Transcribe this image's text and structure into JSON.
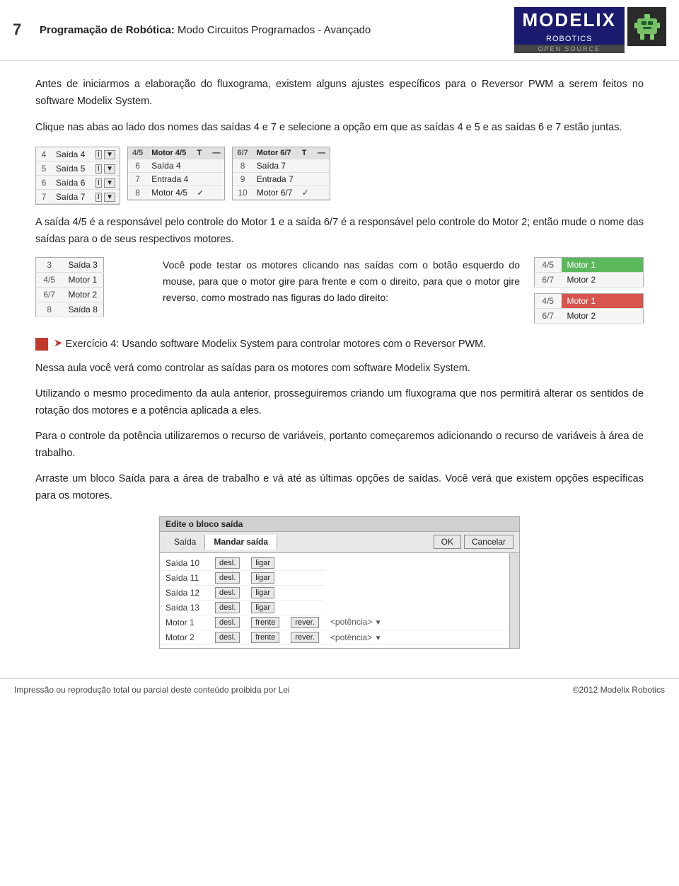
{
  "header": {
    "page_number": "7",
    "title_plain": "Programação de Robótica:",
    "title_subtitle": " Modo Circuitos Programados - Avançado",
    "logo_main": "MODELIX",
    "logo_sub": "ROBOTICS",
    "logo_open": "OPEN SOURCE"
  },
  "intro": {
    "para1": "Antes de iniciarmos a elaboração do fluxograma, existem alguns ajustes específicos para o Reversor PWM a serem feitos no software Modelix System.",
    "para2": "Clique nas abas ao lado dos nomes das saídas 4 e 7 e selecione a opção em que as saídas 4 e 5 e as saídas 6 e 7 estão juntas."
  },
  "ui_table1": {
    "rows": [
      {
        "num": "4",
        "label": "Saída 4"
      },
      {
        "num": "5",
        "label": "Saída 5"
      },
      {
        "num": "6",
        "label": "Saída 6"
      },
      {
        "num": "7",
        "label": "Saída 7"
      }
    ]
  },
  "ui_table2": {
    "header": "Motor 4/5",
    "rows": [
      {
        "num": "6",
        "label": "Saída 4"
      },
      {
        "num": "7",
        "label": "Entrada 4"
      },
      {
        "num": "8",
        "label": "Motor 4/5",
        "checked": true
      }
    ]
  },
  "ui_table3": {
    "header": "Motor 6/7",
    "rows": [
      {
        "num": "8",
        "label": "Saída 7"
      },
      {
        "num": "9",
        "label": "Entrada 7"
      },
      {
        "num": "10",
        "label": "Motor 6/7",
        "checked": true
      }
    ]
  },
  "section1_text": "A saída 4/5 é a responsável pelo controle do Motor 1 e a saída 6/7 é a responsável pelo controle do Motor 2; então mude o nome das saídas para o de seus respectivos motores.",
  "section2_text": "Você pode testar os motores clicando nas saídas com o botão esquerdo do mouse, para que o motor gire para frente e com o direito, para que o motor gire reverso, como mostrado nas figuras do lado direito:",
  "motor_left_table": {
    "rows": [
      {
        "num": "3",
        "label": "Saída 3"
      },
      {
        "num": "4/5",
        "label": "Motor 1"
      },
      {
        "num": "6/7",
        "label": "Motor 2"
      },
      {
        "num": "8",
        "label": "Saída 8"
      }
    ]
  },
  "motor_right_top": {
    "rows": [
      {
        "num": "4/5",
        "label": "Motor 1",
        "style": "green"
      },
      {
        "num": "6/7",
        "label": "Motor 2",
        "style": "normal"
      }
    ]
  },
  "motor_right_bottom": {
    "rows": [
      {
        "num": "4/5",
        "label": "Motor 1",
        "style": "red"
      },
      {
        "num": "6/7",
        "label": "Motor 2",
        "style": "normal"
      }
    ]
  },
  "exercise": {
    "label": "Exercício 4: Usando software Modelix System para controlar motores com o Reversor PWM."
  },
  "para_nessa": "Nessa aula você verá como controlar as saídas para os motores com software Modelix System.",
  "para_utilizando": "Utilizando o mesmo procedimento da aula anterior, prosseguiremos criando um fluxograma que nos permitirá alterar os sentidos de rotação dos motores e a potência aplicada a eles.",
  "para_para": "Para o controle da potência utilizaremos o recurso de variáveis, portanto começaremos adicionando o recurso de variáveis à área de trabalho.",
  "para_arraste": "Arraste um bloco Saída para a área de trabalho e vá até as últimas opções de saídas. Você verá que existem opções específicas para os motores.",
  "dialog": {
    "title": "Edite o bloco saída",
    "tab1": "Saída",
    "tab2": "Mandar saída",
    "btn_ok": "OK",
    "btn_cancel": "Cancelar",
    "rows": [
      {
        "label": "Saída 10",
        "btn1": "desl.",
        "btn2": "ligar"
      },
      {
        "label": "Saída 11",
        "btn1": "desl.",
        "btn2": "ligar"
      },
      {
        "label": "Saída 12",
        "btn1": "desl.",
        "btn2": "ligar"
      },
      {
        "label": "Saída 13",
        "btn1": "desl.",
        "btn2": "ligar"
      },
      {
        "label": "Motor 1",
        "btn1": "desl.",
        "btn2": "frente",
        "btn3": "rever.",
        "extra": "<potência>"
      },
      {
        "label": "Motor 2",
        "btn1": "desl.",
        "btn2": "frente",
        "btn3": "rever.",
        "extra": "<potência>"
      }
    ]
  },
  "footer": {
    "left": "Impressão ou reprodução total ou parcial deste conteúdo proibida por Lei",
    "right": "©2012 Modelix Robotics"
  }
}
